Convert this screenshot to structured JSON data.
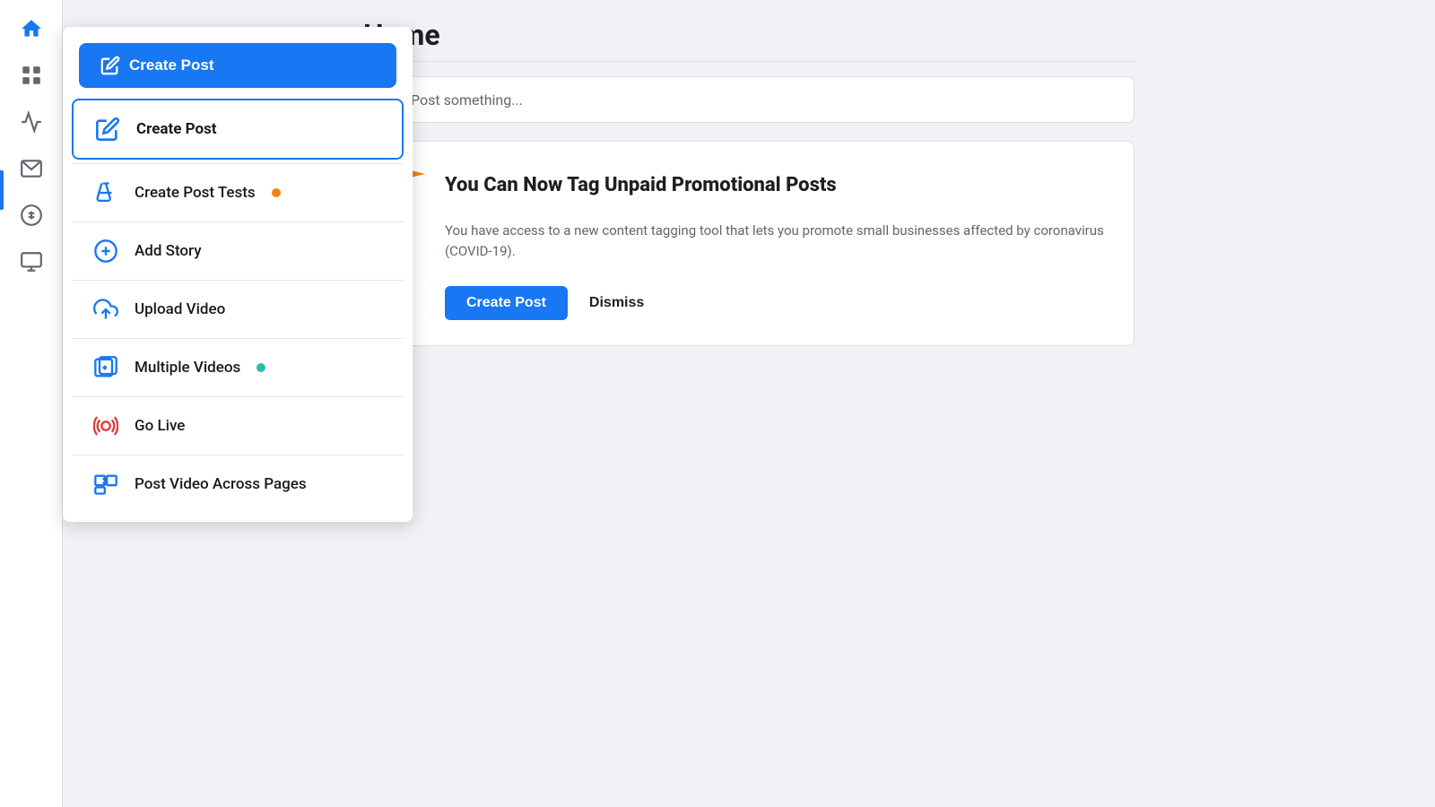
{
  "sidebar": {
    "icons": [
      {
        "name": "home-icon",
        "label": "Home",
        "active": true
      },
      {
        "name": "pages-icon",
        "label": "Pages"
      },
      {
        "name": "activity-icon",
        "label": "Activity"
      },
      {
        "name": "inbox-icon",
        "label": "Inbox"
      },
      {
        "name": "dollar-icon",
        "label": "Monetization"
      },
      {
        "name": "media-icon",
        "label": "Media"
      }
    ]
  },
  "dropdown": {
    "create_post_button": "Create Post",
    "items": [
      {
        "key": "create-post",
        "label": "Create Post",
        "icon": "edit-icon",
        "active": true,
        "badge": null
      },
      {
        "key": "create-post-tests",
        "label": "Create Post Tests",
        "icon": "flask-icon",
        "active": false,
        "badge": "orange"
      },
      {
        "key": "add-story",
        "label": "Add Story",
        "icon": "plus-circle-icon",
        "active": false,
        "badge": null
      },
      {
        "key": "upload-video",
        "label": "Upload Video",
        "icon": "upload-icon",
        "active": false,
        "badge": null
      },
      {
        "key": "multiple-videos",
        "label": "Multiple Videos",
        "icon": "multi-video-icon",
        "active": false,
        "badge": "teal"
      },
      {
        "key": "go-live",
        "label": "Go Live",
        "icon": "live-icon",
        "active": false,
        "badge": null
      },
      {
        "key": "post-video-across-pages",
        "label": "Post Video Across Pages",
        "icon": "cross-post-icon",
        "active": false,
        "badge": null
      }
    ]
  },
  "main": {
    "page_title": "Home",
    "post_bar_placeholder": "Post something...",
    "promo": {
      "title": "You Can Now Tag Unpaid Promotional Posts",
      "body": "You have access to a new content tagging tool that lets you promote small businesses affected by coronavirus (COVID-19).",
      "create_post_label": "Create Post",
      "dismiss_label": "Dismiss"
    }
  }
}
